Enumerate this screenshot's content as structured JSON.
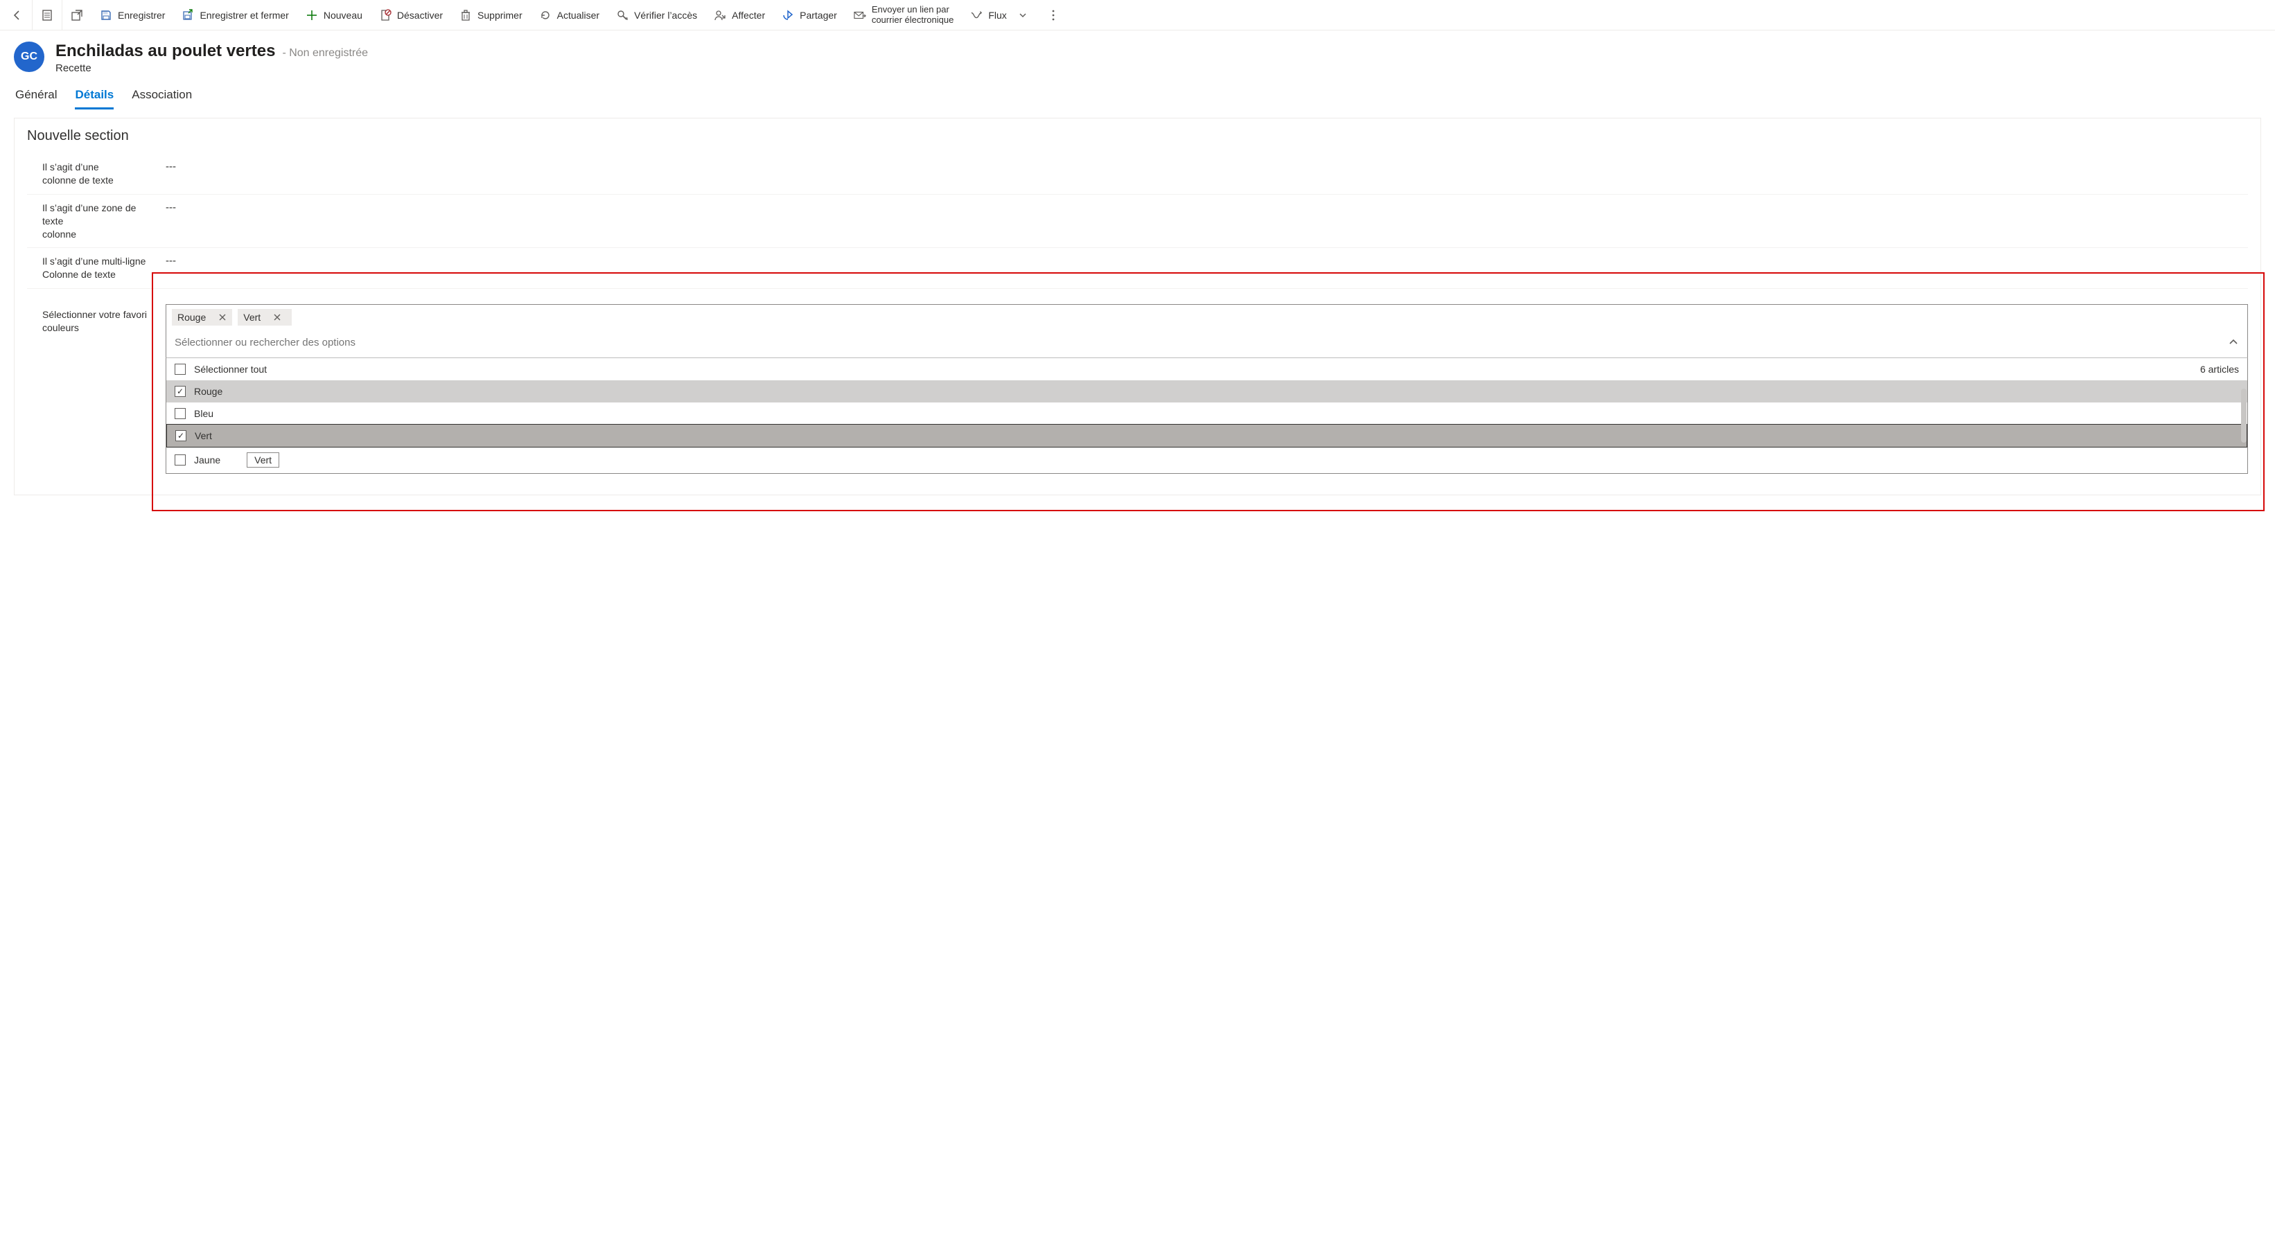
{
  "toolbar": {
    "back": "←",
    "save": "Enregistrer",
    "save_close": "Enregistrer et fermer",
    "new": "Nouveau",
    "deactivate": "Désactiver",
    "delete": "Supprimer",
    "refresh": "Actualiser",
    "check_access": "Vérifier l’accès",
    "assign": "Affecter",
    "share": "Partager",
    "email_link_l1": "Envoyer un lien par",
    "email_link_l2": "courrier électronique",
    "flow": "Flux"
  },
  "record": {
    "initials": "GC",
    "title": "Enchiladas au poulet vertes",
    "status": "- Non enregistrée",
    "entity": "Recette"
  },
  "tabs": {
    "general": "Général",
    "details": "Détails",
    "association": "Association"
  },
  "section": {
    "title": "Nouvelle section",
    "fields": {
      "text_col_l1": "Il s’agit d’une",
      "text_col_l2": "colonne de texte",
      "text_col_val": "---",
      "textarea_l1": "Il s’agit d’une zone de texte",
      "textarea_l2": "colonne",
      "textarea_val": "---",
      "multiline_l1": "Il s’agit d’une multi-ligne",
      "multiline_l2": "Colonne de texte",
      "multiline_val": "---",
      "colors_l1": "Sélectionner votre favori",
      "colors_l2": "couleurs"
    }
  },
  "multiselect": {
    "chips": {
      "0": "Rouge",
      "1": "Vert"
    },
    "placeholder": "Sélectionner ou rechercher des options",
    "select_all": "Sélectionner tout",
    "count": "6 articles",
    "options": {
      "0": "Rouge",
      "1": "Bleu",
      "2": "Vert",
      "3": "Jaune"
    },
    "tooltip": "Vert"
  }
}
